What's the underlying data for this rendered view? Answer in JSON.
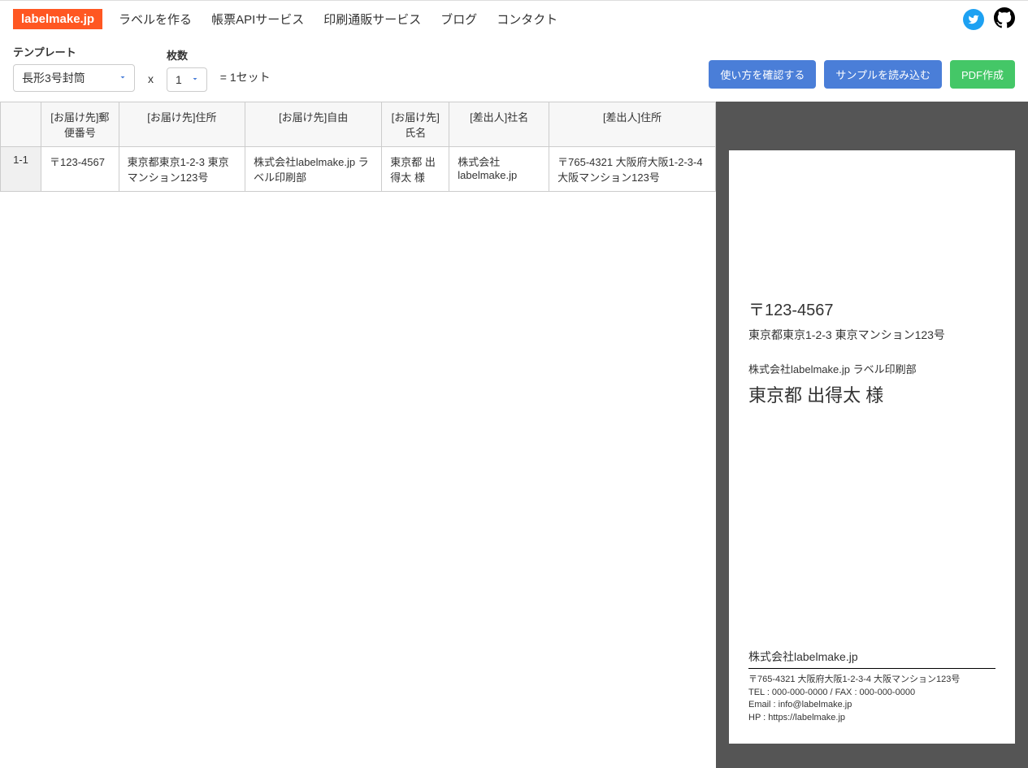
{
  "header": {
    "logo": "labelmake.jp",
    "nav": [
      "ラベルを作る",
      "帳票APIサービス",
      "印刷通販サービス",
      "ブログ",
      "コンタクト"
    ]
  },
  "controls": {
    "template_label": "テンプレート",
    "template_value": "長形3号封筒",
    "count_label": "枚数",
    "count_value": "1",
    "x_text": "x",
    "set_text": "= 1セット"
  },
  "buttons": {
    "usage": "使い方を確認する",
    "sample": "サンプルを読み込む",
    "pdf": "PDF作成"
  },
  "table": {
    "headers": [
      "",
      "[お届け先]郵便番号",
      "[お届け先]住所",
      "[お届け先]自由",
      "[お届け先]氏名",
      "[差出人]社名",
      "[差出人]住所"
    ],
    "rows": [
      {
        "num": "1-1",
        "cells": [
          "〒123-4567",
          "東京都東京1-2-3 東京マンション123号",
          "株式会社labelmake.jp ラベル印刷部",
          "東京都 出得太 様",
          "株式会社labelmake.jp",
          "〒765-4321 大阪府大阪1-2-3-4 大阪マンション123号"
        ]
      }
    ]
  },
  "preview": {
    "postal": "〒123-4567",
    "address": "東京都東京1-2-3 東京マンション123号",
    "free": "株式会社labelmake.jp ラベル印刷部",
    "name": "東京都 出得太 様",
    "sender_company": "株式会社labelmake.jp",
    "sender_address": "〒765-4321 大阪府大阪1-2-3-4 大阪マンション123号",
    "sender_tel": "TEL : 000-000-0000 / FAX : 000-000-0000",
    "sender_email": "Email : info@labelmake.jp",
    "sender_hp": "HP : https://labelmake.jp"
  }
}
